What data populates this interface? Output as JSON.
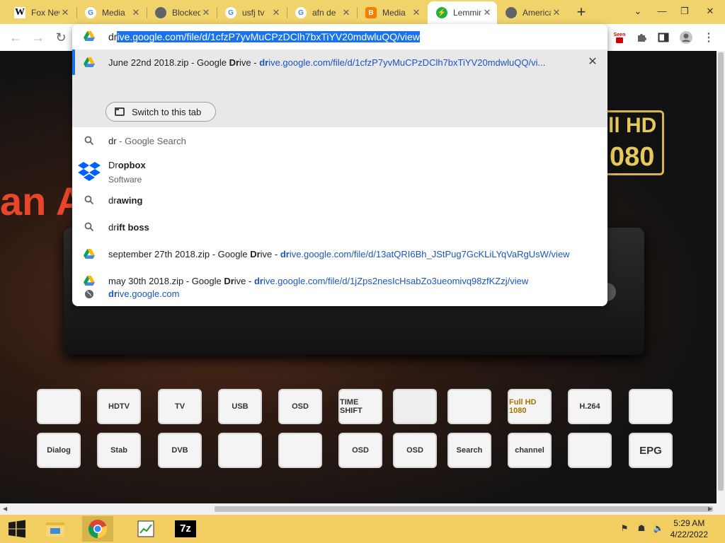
{
  "tabs": [
    {
      "title": "Fox News",
      "favicon": "W"
    },
    {
      "title": "Media",
      "favicon": "G"
    },
    {
      "title": "Blocked",
      "favicon": "globe"
    },
    {
      "title": "usfj tv",
      "favicon": "G"
    },
    {
      "title": "afn de",
      "favicon": "G"
    },
    {
      "title": "Media",
      "favicon": "blogger"
    },
    {
      "title": "Lemmino",
      "favicon": "bolt",
      "active": true
    },
    {
      "title": "American",
      "favicon": "globe"
    }
  ],
  "toolbar": {
    "extension_badge": "Seen"
  },
  "omnibox": {
    "typed": "dr",
    "selected_completion": "ive.google.com/file/d/1cfzP7yvMuCPzDClh7bxTiYV20mdwluQQ/view",
    "suggestions": {
      "current": {
        "title": "June 22nd 2018.zip - Google ",
        "title_bold": "Dr",
        "title_tail": "ive - ",
        "url_bold": "dr",
        "url_rest": "ive.google.com/file/d/1cfzP7yvMuCPzDClh7bxTiYV20mdwluQQ/vi...",
        "switch_label": "Switch to this tab"
      },
      "search": {
        "query": "dr",
        "suffix": " - Google Search"
      },
      "dropbox": {
        "pre": "Dr",
        "bold": "opbox",
        "sub": "Software"
      },
      "drawing": {
        "pre": "dr",
        "bold": "awing"
      },
      "drift": {
        "pre": "dr",
        "bold": "ift boss"
      },
      "sept": {
        "title": "september 27th 2018.zip - Google ",
        "title_bold": "Dr",
        "title_tail": "ive - ",
        "url_bold": "dr",
        "url_rest": "ive.google.com/file/d/13atQRI6Bh_JStPug7GcKLiLYqVaRgUsW/view"
      },
      "may": {
        "title": "may 30th 2018.zip - Google ",
        "title_bold": "Dr",
        "title_tail": "ive - ",
        "url_bold": "dr",
        "url_rest": "ive.google.com/file/d/1jZps2nesIcHsabZo3ueomivq98zfKZzj/view"
      },
      "site": {
        "bold": "dr",
        "rest": "ive.google.com"
      }
    }
  },
  "background": {
    "left_text": "an A",
    "badge_line1": "ll HD",
    "badge_line2": "080",
    "features_row1": [
      "",
      "HDTV",
      "TV",
      "USB",
      "OSD",
      "TIME SHIFT",
      "",
      "",
      "Full HD 1080",
      "H.264",
      ""
    ],
    "features_row2": [
      "Dialog",
      "Stab",
      "DVB",
      "",
      "",
      "OSD",
      "OSD",
      "Search",
      "channel",
      "",
      "EPG"
    ]
  },
  "taskbar": {
    "time": "5:29 AM",
    "date": "4/22/2022"
  }
}
